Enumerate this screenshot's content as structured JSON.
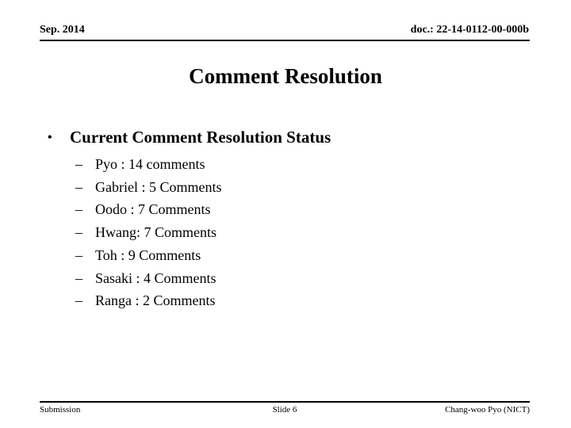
{
  "header": {
    "date": "Sep. 2014",
    "doc": "doc.: 22-14-0112-00-000b"
  },
  "title": "Comment Resolution",
  "body": {
    "bullet_marker": "•",
    "heading": "Current Comment Resolution Status",
    "sub_marker": "–",
    "items": [
      "Pyo : 14 comments",
      "Gabriel : 5 Comments",
      "Oodo : 7 Comments",
      "Hwang: 7 Comments",
      "Toh : 9 Comments",
      "Sasaki : 4 Comments",
      "Ranga : 2 Comments"
    ]
  },
  "footer": {
    "left": "Submission",
    "center": "Slide 6",
    "right": "Chang-woo Pyo (NICT)"
  }
}
